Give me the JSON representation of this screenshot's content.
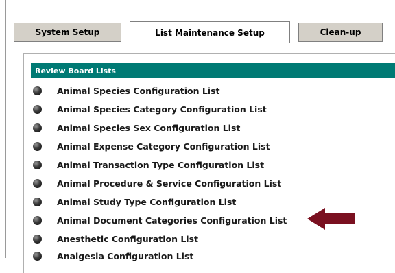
{
  "tabs": [
    {
      "label": "System Setup",
      "active": false
    },
    {
      "label": "List Maintenance Setup",
      "active": true
    },
    {
      "label": "Clean-up",
      "active": false
    }
  ],
  "section": {
    "header": "Review Board Lists"
  },
  "items": [
    {
      "label": "Animal Species Configuration List"
    },
    {
      "label": "Animal Species Category Configuration List"
    },
    {
      "label": "Animal Species Sex Configuration List"
    },
    {
      "label": "Animal Expense Category Configuration List"
    },
    {
      "label": "Animal Transaction Type Configuration List"
    },
    {
      "label": "Animal Procedure & Service Configuration List"
    },
    {
      "label": "Animal Study Type Configuration List"
    },
    {
      "label": "Animal Document Categories Configuration List"
    },
    {
      "label": "Anesthetic Configuration List"
    },
    {
      "label": "Analgesia Configuration List"
    }
  ],
  "colors": {
    "header_bg": "#007a74",
    "arrow": "#7a1020",
    "tab_inactive_bg": "#d4d0c8"
  },
  "annotation": {
    "icon": "arrow-left-icon",
    "points_to_item": 7
  }
}
